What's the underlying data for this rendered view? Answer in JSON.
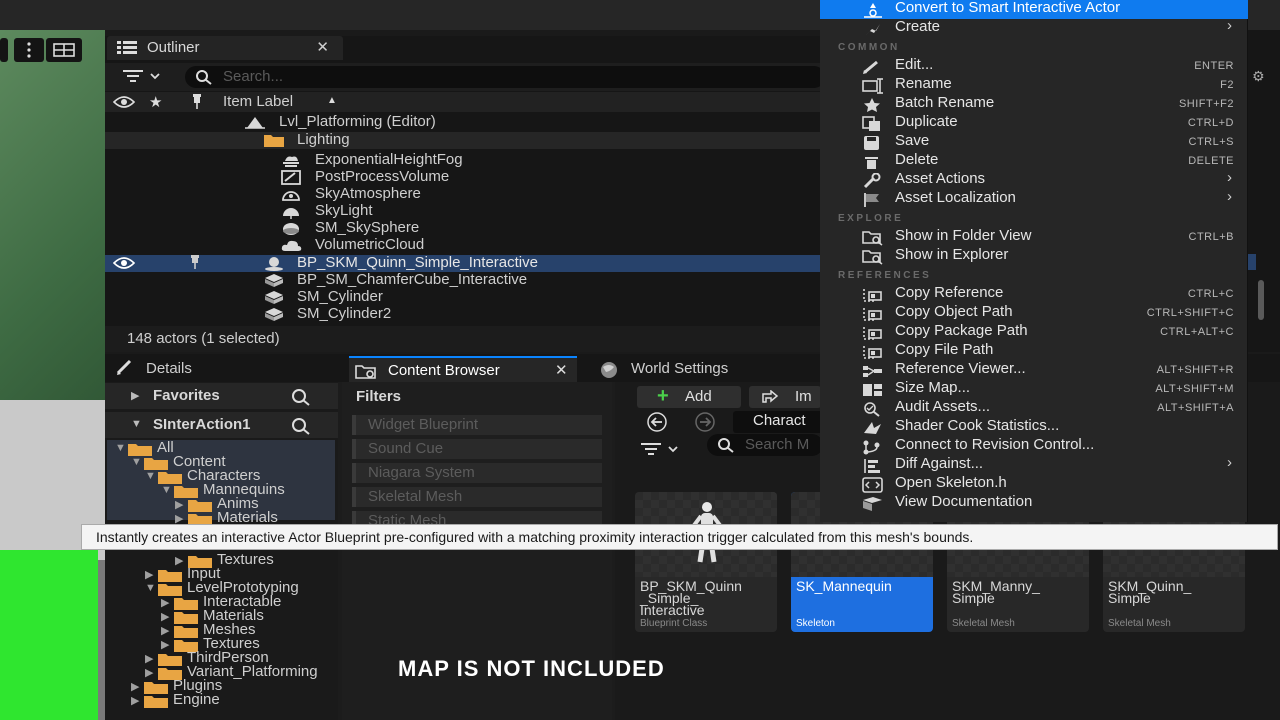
{
  "outliner": {
    "tab_label": "Outliner",
    "search_placeholder": "Search...",
    "column_header": "Item Label",
    "rows": [
      {
        "label": "Lvl_Platforming (Editor)",
        "icon": "level-icon"
      },
      {
        "label": "Lighting",
        "icon": "folder-icon"
      },
      {
        "label": "ExponentialHeightFog",
        "icon": "fog-icon"
      },
      {
        "label": "PostProcessVolume",
        "icon": "postprocess-icon"
      },
      {
        "label": "SkyAtmosphere",
        "icon": "sky-atmosphere-icon"
      },
      {
        "label": "SkyLight",
        "icon": "skylight-icon"
      },
      {
        "label": "SM_SkySphere",
        "icon": "sphere-icon"
      },
      {
        "label": "VolumetricCloud",
        "icon": "cloud-icon"
      },
      {
        "label": "BP_SKM_Quinn_Simple_Interactive",
        "icon": "blueprint-actor-icon",
        "selected": true
      },
      {
        "label": "BP_SM_ChamferCube_Interactive",
        "icon": "static-mesh-icon"
      },
      {
        "label": "SM_Cylinder",
        "icon": "static-mesh-icon"
      },
      {
        "label": "SM_Cylinder2",
        "icon": "static-mesh-icon"
      }
    ],
    "status": "148 actors (1 selected)"
  },
  "lower_tabs": {
    "details": "Details",
    "content_browser": "Content Browser",
    "world_settings": "World Settings"
  },
  "sources": {
    "favorites": "Favorites",
    "collection": "SInterAction1",
    "tree": [
      {
        "label": "All",
        "depth": 0
      },
      {
        "label": "Content",
        "depth": 1
      },
      {
        "label": "Characters",
        "depth": 2
      },
      {
        "label": "Mannequins",
        "depth": 3
      },
      {
        "label": "Anims",
        "depth": 4
      },
      {
        "label": "Materials",
        "depth": 4
      },
      {
        "label": "Textures",
        "depth": 4
      },
      {
        "label": "Input",
        "depth": 2
      },
      {
        "label": "LevelPrototyping",
        "depth": 2
      },
      {
        "label": "Interactable",
        "depth": 3
      },
      {
        "label": "Materials",
        "depth": 3
      },
      {
        "label": "Meshes",
        "depth": 3
      },
      {
        "label": "Textures",
        "depth": 3
      },
      {
        "label": "ThirdPerson",
        "depth": 2
      },
      {
        "label": "Variant_Platforming",
        "depth": 2
      },
      {
        "label": "Plugins",
        "depth": 1
      },
      {
        "label": "Engine",
        "depth": 1
      }
    ]
  },
  "filters": {
    "title": "Filters",
    "items": [
      "Widget Blueprint",
      "Sound Cue",
      "Niagara System",
      "Skeletal Mesh",
      "Static Mesh"
    ]
  },
  "assets": {
    "add_label": "Add",
    "import_label": "Im",
    "path_label": "Charact",
    "search_placeholder": "Search M",
    "tiles": [
      {
        "name": "BP_SKM_Quinn_Simple_Interactive",
        "display": "BP_SKM_Quinn\n_Simple_\nInteractive",
        "type": "Blueprint Class"
      },
      {
        "name": "SK_Mannequin",
        "display": "SK_Mannequin",
        "type": "Skeleton",
        "selected": true
      },
      {
        "name": "SKM_Manny_Simple",
        "display": "SKM_Manny_\nSimple",
        "type": "Skeletal Mesh"
      },
      {
        "name": "SKM_Quinn_Simple",
        "display": "SKM_Quinn_\nSimple",
        "type": "Skeletal Mesh"
      }
    ]
  },
  "context_menu": {
    "top_items": [
      {
        "label": "Convert to Smart Interactive Actor",
        "highlighted": true
      },
      {
        "label": "Create",
        "submenu": true
      }
    ],
    "sections": [
      {
        "title": "COMMON",
        "items": [
          {
            "label": "Edit...",
            "shortcut": "ENTER",
            "icon": "pencil-icon"
          },
          {
            "label": "Rename",
            "shortcut": "F2",
            "icon": "rename-icon"
          },
          {
            "label": "Batch Rename",
            "shortcut": "SHIFT+F2",
            "icon": "star-icon"
          },
          {
            "label": "Duplicate",
            "shortcut": "CTRL+D",
            "icon": "duplicate-icon"
          },
          {
            "label": "Save",
            "shortcut": "CTRL+S",
            "icon": "save-icon"
          },
          {
            "label": "Delete",
            "shortcut": "DELETE",
            "icon": "trash-icon"
          },
          {
            "label": "Asset Actions",
            "shortcut": "",
            "icon": "wrench-icon",
            "submenu": true
          },
          {
            "label": "Asset Localization",
            "shortcut": "",
            "icon": "flag-icon",
            "submenu": true
          }
        ]
      },
      {
        "title": "EXPLORE",
        "items": [
          {
            "label": "Show in Folder View",
            "shortcut": "CTRL+B",
            "icon": "folder-search-icon"
          },
          {
            "label": "Show in Explorer",
            "shortcut": "",
            "icon": "folder-search-icon"
          }
        ]
      },
      {
        "title": "REFERENCES",
        "items": [
          {
            "label": "Copy Reference",
            "shortcut": "CTRL+C",
            "icon": "copy-icon"
          },
          {
            "label": "Copy Object Path",
            "shortcut": "CTRL+SHIFT+C",
            "icon": "copy-icon"
          },
          {
            "label": "Copy Package Path",
            "shortcut": "CTRL+ALT+C",
            "icon": "copy-icon"
          },
          {
            "label": "Copy File Path",
            "shortcut": "",
            "icon": "copy-icon"
          },
          {
            "label": "Reference Viewer...",
            "shortcut": "ALT+SHIFT+R",
            "icon": "reference-viewer-icon"
          },
          {
            "label": "Size Map...",
            "shortcut": "ALT+SHIFT+M",
            "icon": "size-map-icon"
          },
          {
            "label": "Audit Assets...",
            "shortcut": "ALT+SHIFT+A",
            "icon": "audit-icon"
          },
          {
            "label": "Shader Cook Statistics...",
            "shortcut": "",
            "icon": "shader-icon"
          },
          {
            "label": "Connect to Revision Control...",
            "shortcut": "",
            "icon": "revision-control-icon"
          },
          {
            "label": "Diff Against...",
            "shortcut": "",
            "icon": "diff-icon",
            "submenu": true
          },
          {
            "label": "Open Skeleton.h",
            "shortcut": "",
            "icon": "code-icon"
          },
          {
            "label": "View Documentation",
            "shortcut": "",
            "icon": "book-icon"
          }
        ]
      }
    ]
  },
  "tooltip": "Instantly creates an interactive Actor Blueprint pre-configured with a matching proximity interaction trigger calculated from this mesh's bounds.",
  "caption": "MAP IS NOT INCLUDED",
  "colors": {
    "accent": "#0f7bef",
    "selection": "#27426b",
    "folder": "#e8a543",
    "viewport_green": "#2fe62f"
  }
}
